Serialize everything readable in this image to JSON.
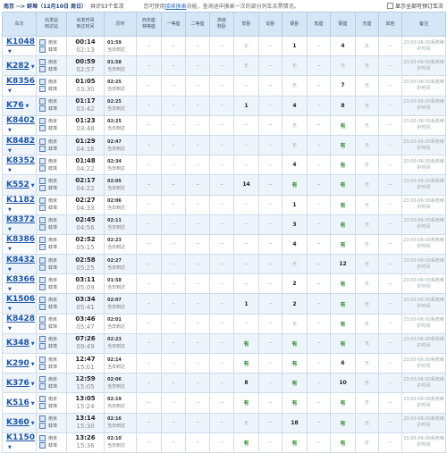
{
  "header": {
    "route": "南京 --> 蚌埠（12月10日 周日）",
    "count": "共计53个车次",
    "tip_pre": "您可使用",
    "tip_link": "接续换乘",
    "tip_post": "功能，查询途中换乘一次的部分列车余票情况。",
    "checkbox_label": "显示全部可预订车次"
  },
  "columns": [
    "车次",
    "出发站\n到达站",
    "出发时间\n到达时间",
    "历时",
    "商务座\n特等座",
    "一等座",
    "二等座",
    "高级\n软卧",
    "软卧",
    "动卧",
    "硬卧",
    "软座",
    "硬座",
    "无座",
    "其他",
    "备注"
  ],
  "rows": [
    {
      "train": "K1048",
      "dep_station": "南京",
      "arr_station": "蚌埠",
      "dep": "00:14",
      "arr": "02:13",
      "dur": "01:59",
      "day": "当日到达",
      "seats": [
        "--",
        "--",
        "--",
        "--",
        "无",
        "--",
        "1",
        "--",
        "4",
        "无",
        "--"
      ],
      "note": "23:00-06:00系统维护时间"
    },
    {
      "train": "K282",
      "dep_station": "南京",
      "arr_station": "蚌埠",
      "dep": "00:59",
      "arr": "02:57",
      "dur": "01:58",
      "day": "当日到达",
      "seats": [
        "--",
        "--",
        "--",
        "--",
        "无",
        "--",
        "无",
        "--",
        "无",
        "无",
        "--"
      ],
      "note": "23:00-06:00系统维护时间"
    },
    {
      "train": "K8356",
      "dep_station": "南京",
      "arr_station": "蚌埠",
      "dep": "01:05",
      "arr": "03:30",
      "dur": "02:25",
      "day": "当日到达",
      "seats": [
        "--",
        "--",
        "--",
        "--",
        "--",
        "--",
        "无",
        "--",
        "7",
        "无",
        "--"
      ],
      "note": "23:00-06:00系统维护时间"
    },
    {
      "train": "K76",
      "dep_station": "南京",
      "arr_station": "蚌埠",
      "dep": "01:17",
      "arr": "03:42",
      "dur": "02:25",
      "day": "当日到达",
      "seats": [
        "--",
        "--",
        "--",
        "--",
        "1",
        "--",
        "4",
        "--",
        "8",
        "无",
        "--"
      ],
      "note": "23:00-06:00系统维护时间"
    },
    {
      "train": "K8402",
      "dep_station": "南京",
      "arr_station": "蚌埠",
      "dep": "01:23",
      "arr": "03:48",
      "dur": "02:25",
      "day": "当日到达",
      "seats": [
        "--",
        "--",
        "--",
        "--",
        "--",
        "--",
        "无",
        "--",
        "有",
        "无",
        "--"
      ],
      "note": "23:00-06:00系统维护时间"
    },
    {
      "train": "K8482",
      "dep_station": "南京",
      "arr_station": "蚌埠",
      "dep": "01:29",
      "arr": "04:16",
      "dur": "02:47",
      "day": "当日到达",
      "seats": [
        "--",
        "--",
        "--",
        "--",
        "--",
        "--",
        "无",
        "--",
        "有",
        "无",
        "--"
      ],
      "note": "23:00-06:00系统维护时间"
    },
    {
      "train": "K8352",
      "dep_station": "南京",
      "arr_station": "蚌埠",
      "dep": "01:48",
      "arr": "04:22",
      "dur": "02:34",
      "day": "当日到达",
      "seats": [
        "--",
        "--",
        "--",
        "--",
        "--",
        "--",
        "4",
        "--",
        "有",
        "无",
        "--"
      ],
      "note": "23:00-06:00系统维护时间"
    },
    {
      "train": "K552",
      "dep_station": "南京",
      "arr_station": "蚌埠",
      "dep": "02:17",
      "arr": "04:22",
      "dur": "02:05",
      "day": "当日到达",
      "seats": [
        "--",
        "--",
        "--",
        "--",
        "14",
        "--",
        "有",
        "--",
        "有",
        "无",
        "--"
      ],
      "note": "23:00-06:00系统维护时间"
    },
    {
      "train": "K1182",
      "dep_station": "南京",
      "arr_station": "蚌埠",
      "dep": "02:27",
      "arr": "04:33",
      "dur": "02:06",
      "day": "当日到达",
      "seats": [
        "--",
        "--",
        "--",
        "--",
        "--",
        "--",
        "1",
        "--",
        "有",
        "无",
        "--"
      ],
      "note": "23:00-06:00系统维护时间"
    },
    {
      "train": "K8372",
      "dep_station": "南京",
      "arr_station": "蚌埠",
      "dep": "02:45",
      "arr": "04:56",
      "dur": "02:11",
      "day": "当日到达",
      "seats": [
        "--",
        "--",
        "--",
        "--",
        "--",
        "--",
        "3",
        "--",
        "有",
        "无",
        "--"
      ],
      "note": "23:00-06:00系统维护时间"
    },
    {
      "train": "K8386",
      "dep_station": "南京",
      "arr_station": "蚌埠",
      "dep": "02:52",
      "arr": "05:15",
      "dur": "02:23",
      "day": "当日到达",
      "seats": [
        "--",
        "--",
        "--",
        "--",
        "--",
        "--",
        "4",
        "--",
        "有",
        "无",
        "--"
      ],
      "note": "23:00-06:00系统维护时间"
    },
    {
      "train": "K8432",
      "dep_station": "南京",
      "arr_station": "蚌埠",
      "dep": "02:58",
      "arr": "05:25",
      "dur": "02:27",
      "day": "当日到达",
      "seats": [
        "--",
        "--",
        "--",
        "--",
        "--",
        "--",
        "无",
        "--",
        "12",
        "无",
        "--"
      ],
      "note": "23:00-06:00系统维护时间"
    },
    {
      "train": "K8366",
      "dep_station": "南京",
      "arr_station": "蚌埠",
      "dep": "03:11",
      "arr": "05:09",
      "dur": "01:58",
      "day": "当日到达",
      "seats": [
        "--",
        "--",
        "--",
        "--",
        "--",
        "--",
        "2",
        "--",
        "有",
        "无",
        "--"
      ],
      "note": "23:00-06:00系统维护时间"
    },
    {
      "train": "K1506",
      "dep_station": "南京",
      "arr_station": "蚌埠",
      "dep": "03:34",
      "arr": "05:41",
      "dur": "02:07",
      "day": "当日到达",
      "seats": [
        "--",
        "--",
        "--",
        "--",
        "1",
        "--",
        "2",
        "--",
        "有",
        "无",
        "--"
      ],
      "note": "23:00-06:00系统维护时间"
    },
    {
      "train": "K8428",
      "dep_station": "南京",
      "arr_station": "蚌埠",
      "dep": "03:46",
      "arr": "05:47",
      "dur": "02:01",
      "day": "当日到达",
      "seats": [
        "--",
        "--",
        "--",
        "--",
        "--",
        "--",
        "无",
        "--",
        "有",
        "无",
        "--"
      ],
      "note": "23:00-06:00系统维护时间"
    },
    {
      "train": "K348",
      "dep_station": "南京",
      "arr_station": "蚌埠",
      "dep": "07:26",
      "arr": "09:49",
      "dur": "02:23",
      "day": "当日到达",
      "seats": [
        "--",
        "--",
        "--",
        "--",
        "有",
        "--",
        "有",
        "--",
        "有",
        "无",
        "--"
      ],
      "note": "23:00-06:00系统维护时间"
    },
    {
      "train": "K290",
      "dep_station": "南京",
      "arr_station": "蚌埠",
      "dep": "12:47",
      "arr": "15:01",
      "dur": "02:14",
      "day": "当日到达",
      "seats": [
        "--",
        "--",
        "--",
        "--",
        "有",
        "--",
        "有",
        "--",
        "6",
        "无",
        "--"
      ],
      "note": "23:00-06:00系统维护时间"
    },
    {
      "train": "K376",
      "dep_station": "南京",
      "arr_station": "蚌埠",
      "dep": "12:59",
      "arr": "15:05",
      "dur": "02:06",
      "day": "当日到达",
      "seats": [
        "--",
        "--",
        "--",
        "--",
        "8",
        "--",
        "有",
        "--",
        "10",
        "无",
        "--"
      ],
      "note": "23:00-06:00系统维护时间"
    },
    {
      "train": "K516",
      "dep_station": "南京",
      "arr_station": "蚌埠",
      "dep": "13:05",
      "arr": "15:24",
      "dur": "02:19",
      "day": "当日到达",
      "seats": [
        "--",
        "--",
        "--",
        "--",
        "有",
        "--",
        "有",
        "--",
        "有",
        "无",
        "--"
      ],
      "note": "23:00-06:00系统维护时间"
    },
    {
      "train": "K360",
      "dep_station": "南京",
      "arr_station": "蚌埠",
      "dep": "13:14",
      "arr": "15:30",
      "dur": "02:16",
      "day": "当日到达",
      "seats": [
        "--",
        "--",
        "--",
        "--",
        "无",
        "--",
        "18",
        "--",
        "有",
        "无",
        "--"
      ],
      "note": "23:00-06:00系统维护时间"
    },
    {
      "train": "K1150",
      "dep_station": "南京",
      "arr_station": "蚌埠",
      "dep": "13:26",
      "arr": "15:36",
      "dur": "02:10",
      "day": "当日到达",
      "seats": [
        "--",
        "--",
        "--",
        "--",
        "有",
        "--",
        "有",
        "--",
        "有",
        "无",
        "--"
      ],
      "note": "23:00-06:00系统维护时间"
    }
  ]
}
